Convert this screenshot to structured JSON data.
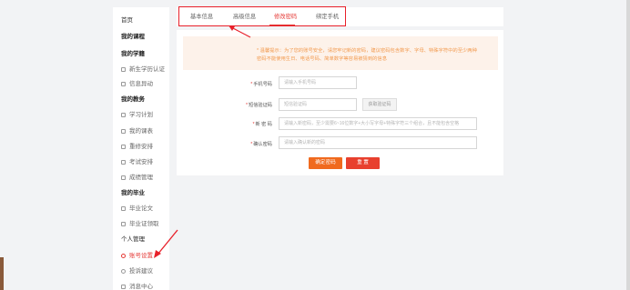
{
  "sidebar": {
    "home": "首页",
    "my_courses": "我的课程",
    "section_study": "我的学籍",
    "study_items": [
      "新生学历认证",
      "信息异动"
    ],
    "section_affairs": "我的教务",
    "affairs_items": [
      "学习计划",
      "我的课表",
      "重修安排",
      "考试安排",
      "成绩管理"
    ],
    "section_graduate": "我的毕业",
    "graduate_items": [
      "毕业论文",
      "毕业证领取"
    ],
    "section_personal": "个人管理",
    "personal_items": [
      "账号设置",
      "投诉建议",
      "消息中心"
    ],
    "active_item": "账号设置"
  },
  "tabs": [
    {
      "label": "基本信息",
      "active": false
    },
    {
      "label": "高级信息",
      "active": false
    },
    {
      "label": "修改密码",
      "active": true
    },
    {
      "label": "绑定手机",
      "active": false
    }
  ],
  "notice": {
    "line1": "* 温馨提示：为了您的账号安全，请您牢记新的密码，建议密码包含数字、字母、特殊字符中的至少两种",
    "line2": "密码不能使用生日、电话号码、简单数字等容易被猜到的信息"
  },
  "form": {
    "phone_label": "手机号码",
    "phone_placeholder": "请输入手机号码",
    "code_label": "短信验证码",
    "code_placeholder": "短信验证码",
    "code_button": "获取验证码",
    "password_label": "新 密 码",
    "password_placeholder": "请输入新密码，至少需要6~16位数字+大小写字母+特殊字符三个组合，且不能包含空格",
    "confirm_label": "确认密码",
    "confirm_placeholder": "请输入确认新的密码",
    "submit_label": "确定密码",
    "reset_label": "重 置"
  },
  "colors": {
    "accent": "#e53935",
    "orange": "#f06a1e",
    "notice_bg": "#fdf2ea",
    "notice_text": "#f29b50",
    "highlight_box": "#e8202a"
  }
}
